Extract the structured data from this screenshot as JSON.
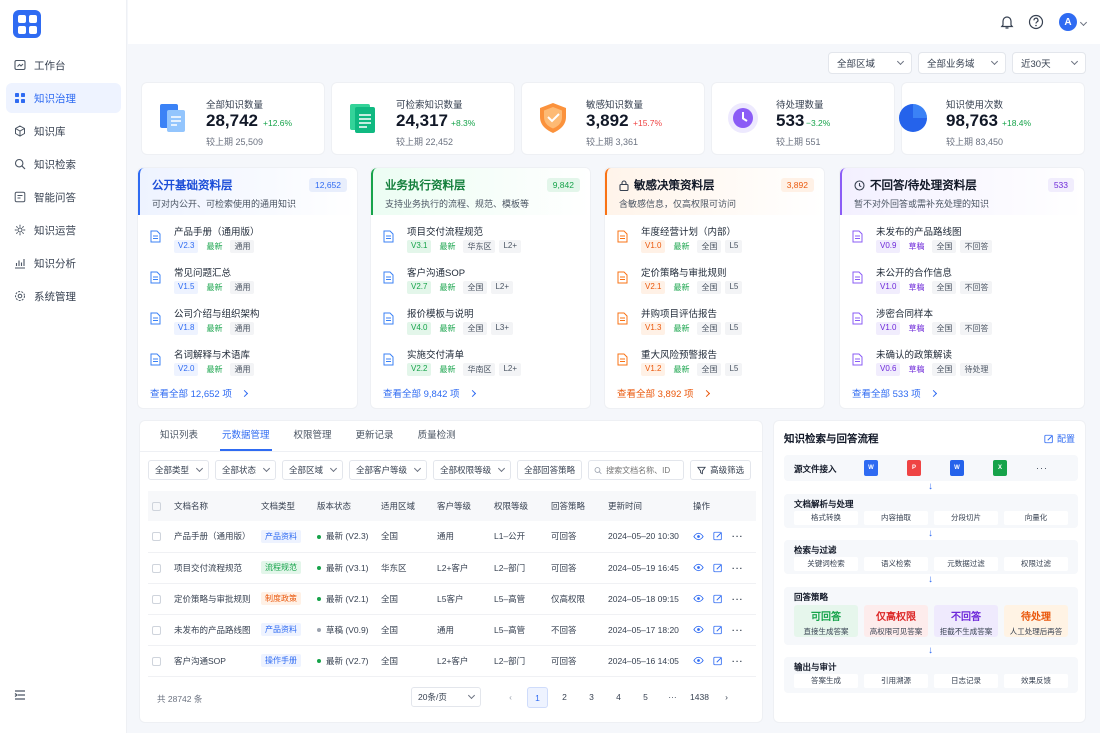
{
  "nav": {
    "items": [
      {
        "label": "工作台",
        "icon": "workbench-icon"
      },
      {
        "label": "知识治理",
        "icon": "grid-icon",
        "active": true
      },
      {
        "label": "知识库",
        "icon": "cube-icon"
      },
      {
        "label": "知识检索",
        "icon": "search-icon"
      },
      {
        "label": "智能问答",
        "icon": "chat-icon"
      },
      {
        "label": "知识运营",
        "icon": "gear-icon"
      },
      {
        "label": "知识分析",
        "icon": "chart-icon"
      },
      {
        "label": "系统管理",
        "icon": "settings-icon"
      }
    ]
  },
  "header": {
    "avatar_letter": "A"
  },
  "filters": {
    "region": "全部区域",
    "business": "全部业务域",
    "period": "近30天"
  },
  "stats": [
    {
      "label": "全部知识数量",
      "value": "28,742",
      "change": "+12.6%",
      "prev": "较上期 25,509",
      "color": "#16a34a"
    },
    {
      "label": "可检索知识数量",
      "value": "24,317",
      "change": "+8.3%",
      "prev": "较上期 22,452",
      "color": "#16a34a"
    },
    {
      "label": "敏感知识数量",
      "value": "3,892",
      "change": "+15.7%",
      "prev": "较上期 3,361",
      "color": "#ef4444"
    },
    {
      "label": "待处理数量",
      "value": "533",
      "change": "−3.2%",
      "prev": "较上期 551",
      "color": "#16a34a"
    },
    {
      "label": "知识使用次数",
      "value": "98,763",
      "change": "+18.4%",
      "prev": "较上期 83,450",
      "color": "#16a34a"
    }
  ],
  "layers": [
    {
      "title": "公开基础资料层",
      "subtitle": "可对内公开、可检索使用的通用知识",
      "count": "12,652",
      "footer": "查看全部  12,652 项",
      "items": [
        {
          "name": "产品手册（通用版）",
          "version": "V2.3",
          "status": "最新",
          "tags": [
            "通用"
          ]
        },
        {
          "name": "常见问题汇总",
          "version": "V1.5",
          "status": "最新",
          "tags": [
            "通用"
          ]
        },
        {
          "name": "公司介绍与组织架构",
          "version": "V1.8",
          "status": "最新",
          "tags": [
            "通用"
          ]
        },
        {
          "name": "名词解释与术语库",
          "version": "V2.0",
          "status": "最新",
          "tags": [
            "通用"
          ]
        }
      ]
    },
    {
      "title": "业务执行资料层",
      "subtitle": "支持业务执行的流程、规范、模板等",
      "count": "9,842",
      "footer": "查看全部  9,842 项",
      "items": [
        {
          "name": "项目交付流程规范",
          "version": "V3.1",
          "status": "最新",
          "tags": [
            "华东区",
            "L2+"
          ]
        },
        {
          "name": "客户沟通SOP",
          "version": "V2.7",
          "status": "最新",
          "tags": [
            "全国",
            "L2+"
          ]
        },
        {
          "name": "报价模板与说明",
          "version": "V4.0",
          "status": "最新",
          "tags": [
            "全国",
            "L3+"
          ]
        },
        {
          "name": "实施交付清单",
          "version": "V2.2",
          "status": "最新",
          "tags": [
            "华南区",
            "L2+"
          ]
        }
      ]
    },
    {
      "title": "敏感决策资料层",
      "subtitle": "含敏感信息，仅高权限可访问",
      "count": "3,892",
      "footer": "查看全部  3,892 项",
      "items": [
        {
          "name": "年度经营计划（内部）",
          "version": "V1.0",
          "status": "最新",
          "tags": [
            "全国",
            "L5"
          ]
        },
        {
          "name": "定价策略与审批规则",
          "version": "V2.1",
          "status": "最新",
          "tags": [
            "全国",
            "L5"
          ]
        },
        {
          "name": "并购项目评估报告",
          "version": "V1.3",
          "status": "最新",
          "tags": [
            "全国",
            "L5"
          ]
        },
        {
          "name": "重大风险预警报告",
          "version": "V1.2",
          "status": "最新",
          "tags": [
            "全国",
            "L5"
          ]
        }
      ]
    },
    {
      "title": "不回答/待处理资料层",
      "subtitle": "暂不对外回答或需补充处理的知识",
      "count": "533",
      "footer": "查看全部  533 项",
      "items": [
        {
          "name": "未发布的产品路线图",
          "version": "V0.9",
          "status": "草稿",
          "tags": [
            "全国",
            "不回答"
          ]
        },
        {
          "name": "未公开的合作信息",
          "version": "V1.0",
          "status": "草稿",
          "tags": [
            "全国",
            "不回答"
          ]
        },
        {
          "name": "涉密合同样本",
          "version": "V1.0",
          "status": "草稿",
          "tags": [
            "全国",
            "不回答"
          ]
        },
        {
          "name": "未确认的政策解读",
          "version": "V0.6",
          "status": "草稿",
          "tags": [
            "全国",
            "待处理"
          ]
        }
      ]
    }
  ],
  "tabs": [
    "知识列表",
    "元数据管理",
    "权限管理",
    "更新记录",
    "质量检测"
  ],
  "list_filters": [
    "全部类型",
    "全部状态",
    "全部区域",
    "全部客户等级",
    "全部权限等级",
    "全部回答策略"
  ],
  "search": {
    "placeholder": "搜索文档名称、ID"
  },
  "advanced_filter": "高级筛选",
  "table": {
    "columns": [
      "文档名称",
      "文档类型",
      "版本状态",
      "适用区域",
      "客户等级",
      "权限等级",
      "回答策略",
      "更新时间",
      "操作"
    ],
    "rows": [
      {
        "name": "产品手册（通用版）",
        "type": "产品资料",
        "version": "最新 (V2.3)",
        "region": "全国",
        "client": "通用",
        "perm": "L1–公开",
        "strategy": "可回答",
        "time": "2024–05–20 10:30"
      },
      {
        "name": "项目交付流程规范",
        "type": "流程规范",
        "version": "最新 (V3.1)",
        "region": "华东区",
        "client": "L2+客户",
        "perm": "L2–部门",
        "strategy": "可回答",
        "time": "2024–05–19 16:45"
      },
      {
        "name": "定价策略与审批规则",
        "type": "制度政策",
        "version": "最新 (V2.1)",
        "region": "全国",
        "client": "L5客户",
        "perm": "L5–高管",
        "strategy": "仅高权限",
        "time": "2024–05–18 09:15"
      },
      {
        "name": "未发布的产品路线图",
        "type": "产品资料",
        "version": "草稿 (V0.9)",
        "region": "全国",
        "client": "通用",
        "perm": "L5–高管",
        "strategy": "不回答",
        "time": "2024–05–17 18:20"
      },
      {
        "name": "客户沟通SOP",
        "type": "操作手册",
        "version": "最新 (V2.7)",
        "region": "全国",
        "client": "L2+客户",
        "perm": "L2–部门",
        "strategy": "可回答",
        "time": "2024–05–16 14:05"
      }
    ]
  },
  "pagination": {
    "total": "共 28742 条",
    "page_size": "20条/页",
    "pages": [
      "1",
      "2",
      "3",
      "4",
      "5",
      "···",
      "1438"
    ]
  },
  "flow": {
    "title": "知识检索与回答流程",
    "config": "配置",
    "source_label": "源文件接入",
    "source_files": [
      "W",
      "P",
      "W",
      "X"
    ],
    "stages": [
      {
        "title": "文档解析与处理",
        "steps": [
          "格式转换",
          "内容抽取",
          "分段切片",
          "向量化"
        ]
      },
      {
        "title": "检索与过滤",
        "steps": [
          "关键词检索",
          "语义检索",
          "元数据过滤",
          "权限过滤"
        ]
      },
      {
        "title": "回答策略",
        "strategies": [
          {
            "name": "可回答",
            "desc": "直接生成答案"
          },
          {
            "name": "仅高权限",
            "desc": "高权限可见答案"
          },
          {
            "name": "不回答",
            "desc": "拒截不生成答案"
          },
          {
            "name": "待处理",
            "desc": "人工处理后再答"
          }
        ]
      },
      {
        "title": "输出与审计",
        "steps": [
          "答案生成",
          "引用溯源",
          "日志记录",
          "效果反馈"
        ]
      }
    ]
  }
}
